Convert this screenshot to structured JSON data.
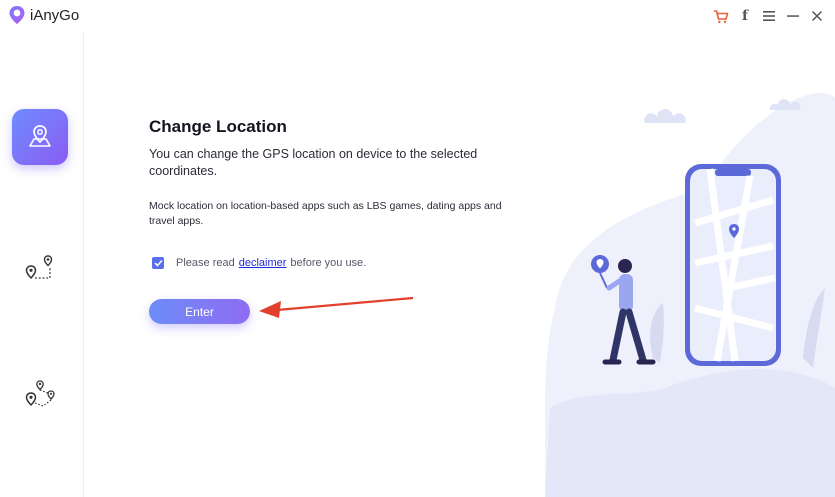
{
  "app": {
    "title": "iAnyGo"
  },
  "titlebar": {
    "icons": [
      "cart-icon",
      "facebook-icon",
      "menu-icon",
      "minimize-icon",
      "close-icon"
    ],
    "facebook_glyph": "f"
  },
  "sidebar": {
    "items": [
      {
        "name": "change-location",
        "icon": "location-map-pin-icon",
        "active": true
      },
      {
        "name": "single-spot-movement",
        "icon": "two-spot-route-icon",
        "active": false
      },
      {
        "name": "multi-spot-movement",
        "icon": "multi-spot-route-icon",
        "active": false
      }
    ]
  },
  "main": {
    "heading": "Change Location",
    "description": "You can change the GPS location on device to the selected coordinates.",
    "note": "Mock location on location-based apps such as LBS games, dating apps and travel apps.",
    "agree": {
      "checked": true,
      "prefix": "Please read",
      "link": "declaimer",
      "suffix": "before you use."
    },
    "enter_label": "Enter"
  },
  "colors": {
    "accent_start": "#6d8cf8",
    "accent_end": "#8f6cf3",
    "cart": "#e8603c",
    "arrow": "#e2402c",
    "link": "#1d2bd6"
  }
}
